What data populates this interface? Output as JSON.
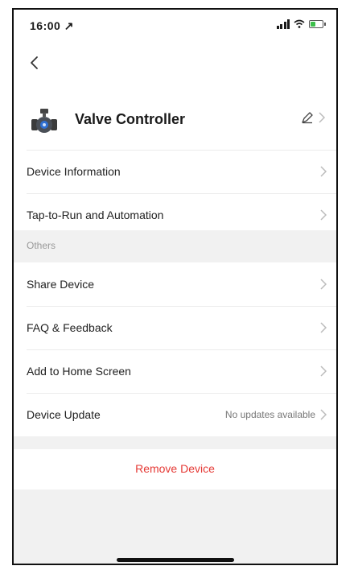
{
  "status_bar": {
    "time": "16:00 ↗"
  },
  "device": {
    "name": "Valve Controller"
  },
  "menu": {
    "device_information": "Device Information",
    "tap_to_run": "Tap-to-Run and Automation",
    "others_header": "Others",
    "share_device": "Share Device",
    "faq_feedback": "FAQ & Feedback",
    "add_to_home": "Add to Home Screen",
    "device_update": "Device Update",
    "device_update_value": "No updates available"
  },
  "actions": {
    "remove_device": "Remove Device"
  },
  "colors": {
    "remove_text": "#e53935",
    "section_background": "#f1f1f1",
    "battery": "#3cbf4a"
  },
  "icons": {
    "back": "chevron-left-icon",
    "edit": "pencil-icon",
    "row": "chevron-right-icon",
    "device": "valve-icon"
  }
}
